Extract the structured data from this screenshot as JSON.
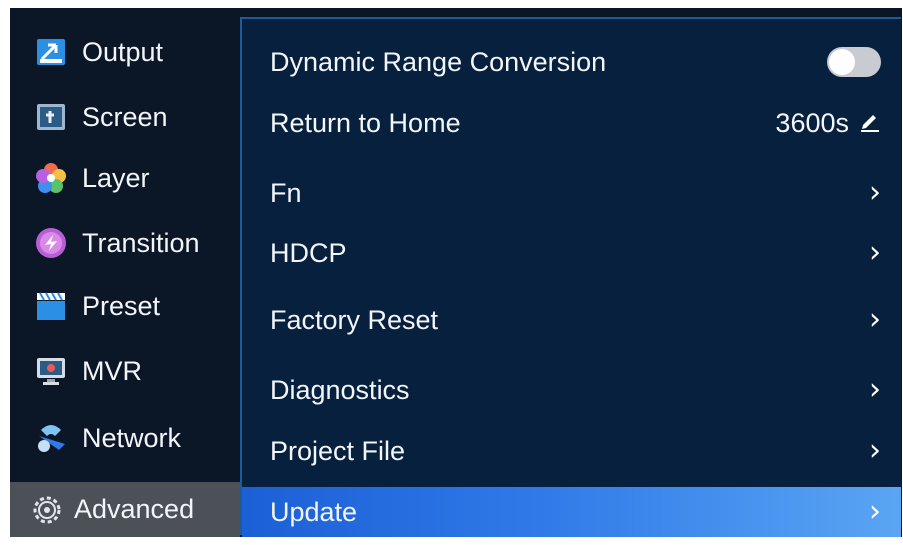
{
  "sidebar": {
    "items": [
      {
        "label": "Output",
        "icon": "output-icon"
      },
      {
        "label": "Screen",
        "icon": "screen-icon"
      },
      {
        "label": "Layer",
        "icon": "layer-icon"
      },
      {
        "label": "Transition",
        "icon": "transition-icon"
      },
      {
        "label": "Preset",
        "icon": "preset-icon"
      },
      {
        "label": "MVR",
        "icon": "mvr-icon"
      },
      {
        "label": "Network",
        "icon": "network-icon"
      },
      {
        "label": "Advanced",
        "icon": "gear-icon",
        "active": true
      }
    ]
  },
  "panel": {
    "dynamic_range": {
      "label": "Dynamic Range Conversion",
      "enabled": false
    },
    "return_home": {
      "label": "Return to Home",
      "value": "3600s"
    },
    "items": [
      {
        "label": "Fn"
      },
      {
        "label": "HDCP"
      },
      {
        "label": "Factory Reset"
      },
      {
        "label": "Diagnostics"
      },
      {
        "label": "Project File"
      },
      {
        "label": "Update",
        "active": true
      }
    ]
  },
  "colors": {
    "accent": "#2f7ae8",
    "panel_bg": "#07203d",
    "sidebar_bg": "#0b1626",
    "active_side": "#4c5158"
  }
}
